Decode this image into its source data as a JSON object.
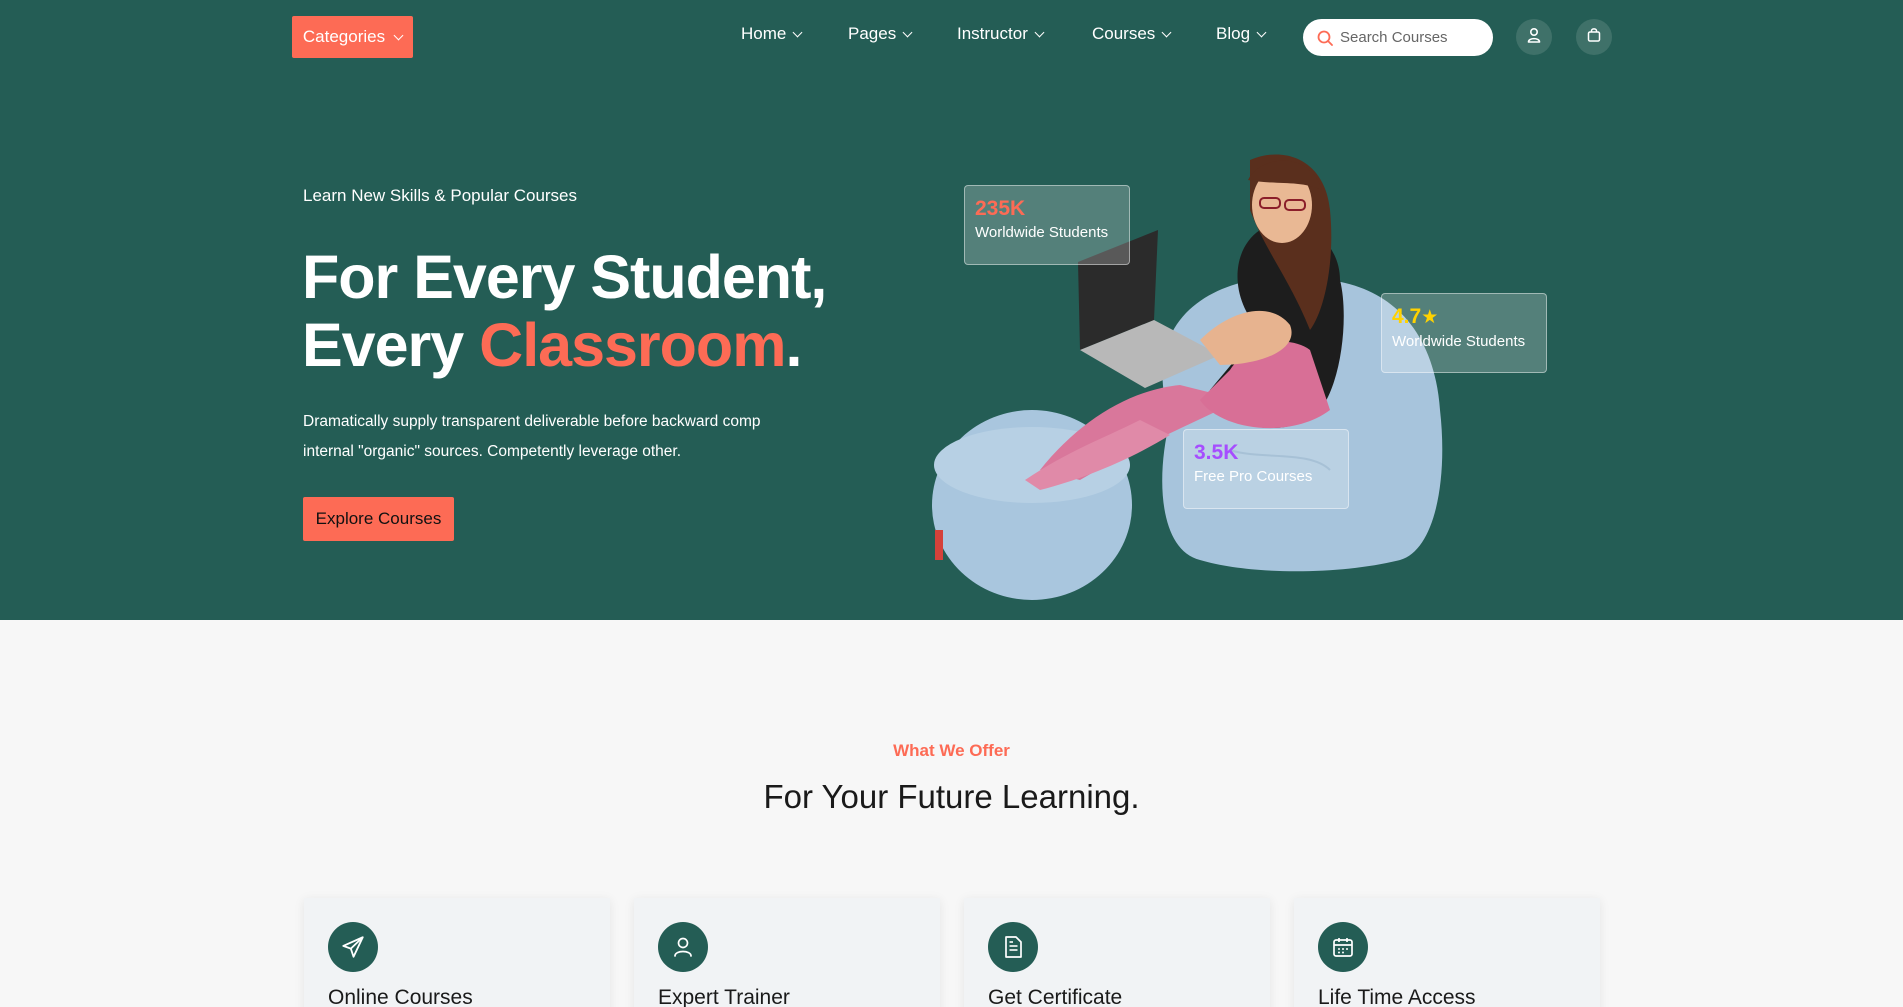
{
  "nav": {
    "categories_label": "Categories",
    "items": [
      {
        "label": "Home"
      },
      {
        "label": "Pages"
      },
      {
        "label": "Instructor"
      },
      {
        "label": "Courses"
      },
      {
        "label": "Blog"
      }
    ],
    "search_placeholder": "Search Courses"
  },
  "hero": {
    "subtitle": "Learn New Skills & Popular Courses",
    "title_line1": "For Every Student,",
    "title_line2_prefix": "Every ",
    "title_line2_accent": "Classroom",
    "title_line2_suffix": ".",
    "description": "Dramatically supply transparent deliverable before backward comp internal \"organic\" sources. Competently leverage other.",
    "cta_label": "Explore Courses",
    "stats": [
      {
        "value": "235K",
        "label": "Worldwide Students",
        "color": "#fd6b55"
      },
      {
        "value": "4.7",
        "label": "Worldwide Students",
        "color": "#ffd200"
      },
      {
        "value": "3.5K",
        "label": "Free Pro Courses",
        "color": "#a64dff"
      }
    ]
  },
  "offer": {
    "tag": "What We Offer",
    "title": "For Your Future Learning.",
    "cards": [
      {
        "title": "Online Courses",
        "icon": "paper-plane-icon"
      },
      {
        "title": "Expert Trainer",
        "icon": "user-icon"
      },
      {
        "title": "Get Certificate",
        "icon": "document-icon"
      },
      {
        "title": "Life Time Access",
        "icon": "calendar-icon"
      }
    ]
  },
  "colors": {
    "primary": "#245d55",
    "accent": "#fd6b55",
    "background": "#f7f7f7"
  }
}
